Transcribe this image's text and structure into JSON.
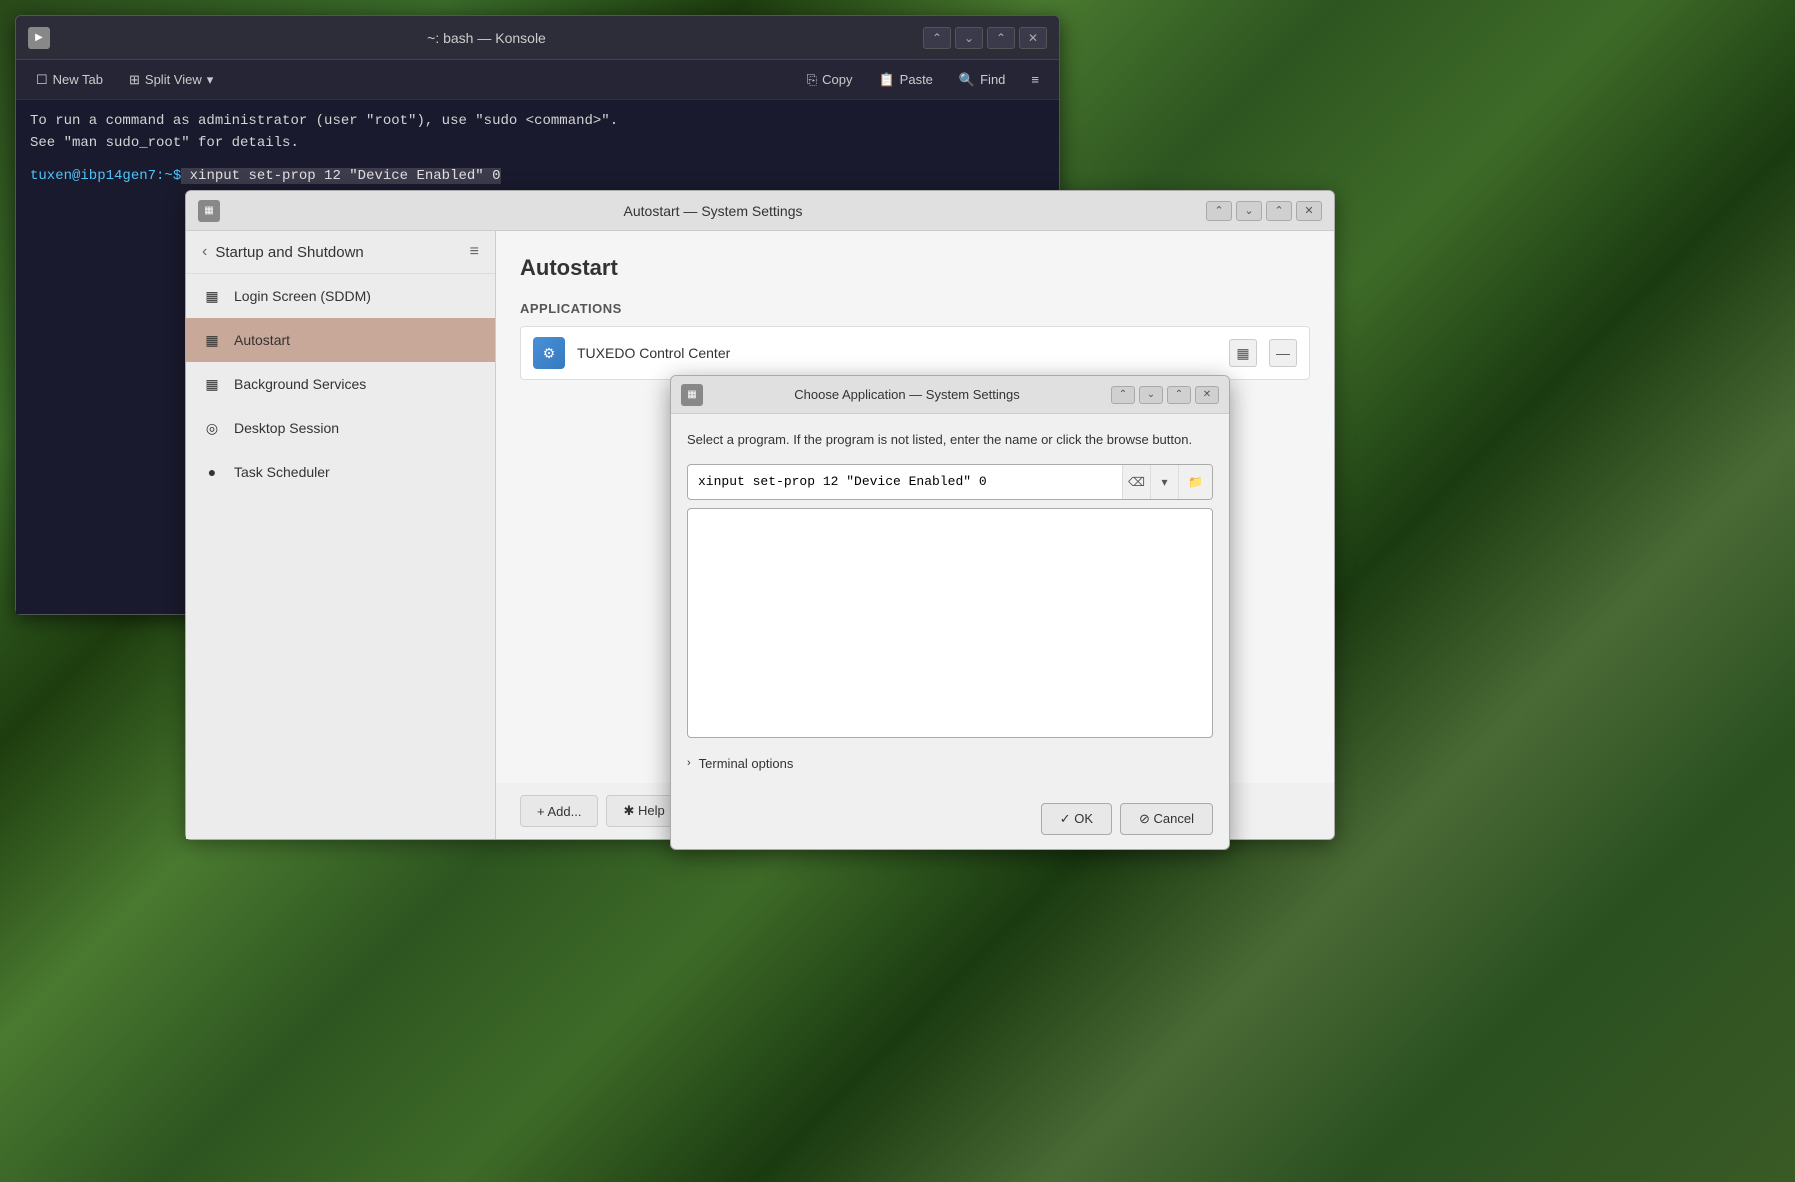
{
  "desktop": {
    "background": "geometric green"
  },
  "konsole": {
    "title": "~: bash — Konsole",
    "icon": "▶",
    "toolbar": {
      "new_tab": "New Tab",
      "split_view": "Split View",
      "copy": "Copy",
      "paste": "Paste",
      "find": "Find",
      "menu_icon": "≡"
    },
    "wm_buttons": {
      "minimize_all": "⌃",
      "minimize": "⌄",
      "maximize": "⌃",
      "close": "✕"
    },
    "terminal": {
      "line1": "To run a command as administrator (user \"root\"), use \"sudo <command>\".",
      "line2": "See \"man sudo_root\" for details.",
      "prompt": "tuxen@ibp14gen7:~$",
      "command": " xinput set-prop 12 \"Device Enabled\" 0"
    }
  },
  "sysset": {
    "title": "Autostart — System Settings",
    "icon": "▦",
    "wm_buttons": {
      "minimize_all": "⌃",
      "minimize": "⌄",
      "maximize": "⌃",
      "close": "✕"
    },
    "sidebar": {
      "back_label": "Startup and Shutdown",
      "menu_icon": "≡",
      "items": [
        {
          "id": "login-screen",
          "label": "Login Screen (SDDM)",
          "icon": "▦"
        },
        {
          "id": "autostart",
          "label": "Autostart",
          "icon": "▦",
          "active": true
        },
        {
          "id": "background-services",
          "label": "Background Services",
          "icon": "▦"
        },
        {
          "id": "desktop-session",
          "label": "Desktop Session",
          "icon": "◎"
        },
        {
          "id": "task-scheduler",
          "label": "Task Scheduler",
          "icon": "●"
        }
      ]
    },
    "main": {
      "title": "Autostart",
      "section_label": "Applications",
      "apps": [
        {
          "name": "TUXEDO Control Center",
          "icon": "⚙"
        }
      ],
      "app_actions": {
        "settings": "▦",
        "remove": "—"
      }
    },
    "bottom": {
      "add_label": "+ Add...",
      "help_label": "✱ Help"
    }
  },
  "choose_app": {
    "title": "Choose Application — System Settings",
    "icon": "▦",
    "wm_buttons": {
      "minimize_all": "⌃",
      "minimize": "⌄",
      "maximize": "⌃",
      "close": "✕"
    },
    "description": "Select a program. If the program is not listed, enter the name or click the browse button.",
    "input_value": "xinput set-prop 12 \"Device Enabled\" 0",
    "input_placeholder": "",
    "clear_btn": "⌫",
    "dropdown_btn": "▾",
    "browse_btn": "📁",
    "terminal_options_label": "Terminal options",
    "chevron_icon": "›",
    "ok_label": "✓ OK",
    "cancel_label": "⊘ Cancel"
  }
}
